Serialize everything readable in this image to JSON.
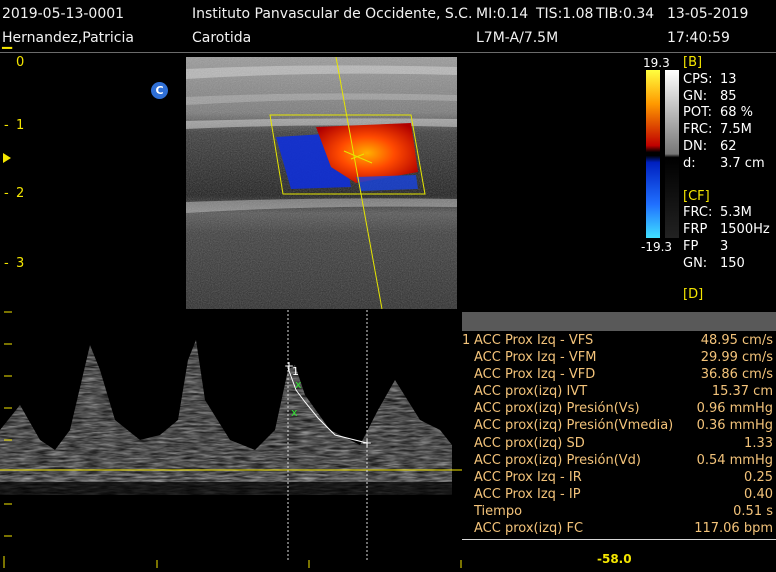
{
  "header": {
    "study_id": "2019-05-13-0001",
    "patient_name": "Hernandez,Patricia",
    "institution": "Instituto Panvascular de Occidente, S.C.",
    "mi": "MI:0.14",
    "tis": "TIS:1.08",
    "tib": "TIB:0.34",
    "date": "13-05-2019",
    "exam": "Carotida",
    "probe": "L7M-A/7.5M",
    "time": "17:40:59"
  },
  "depth_scale": [
    "0",
    "1",
    "2",
    "3"
  ],
  "badge": "C",
  "colorbar": {
    "max": "19.3",
    "min": "-19.3"
  },
  "b_params": {
    "title": "[B]",
    "rows": [
      {
        "k": "CPS:",
        "v": "13"
      },
      {
        "k": "GN:",
        "v": "85"
      },
      {
        "k": "POT:",
        "v": "68 %"
      },
      {
        "k": "FRC:",
        "v": "7.5M"
      },
      {
        "k": "DN:",
        "v": "62"
      },
      {
        "k": "d:",
        "v": "3.7 cm"
      }
    ]
  },
  "cf_params": {
    "title": "[CF]",
    "rows": [
      {
        "k": "FRC:",
        "v": "5.3M"
      },
      {
        "k": "FRP",
        "v": "1500Hz"
      },
      {
        "k": "FP",
        "v": "3"
      },
      {
        "k": "GN:",
        "v": "150"
      }
    ]
  },
  "d_params": {
    "title": "[D]"
  },
  "measurements": {
    "index": "1",
    "rows": [
      {
        "label": "ACC Prox Izq - VFS",
        "value": "48.95 cm/s"
      },
      {
        "label": "ACC Prox Izq - VFM",
        "value": "29.99 cm/s"
      },
      {
        "label": "ACC Prox Izq - VFD",
        "value": "36.86 cm/s"
      },
      {
        "label": "ACC prox(izq) IVT",
        "value": "15.37 cm"
      },
      {
        "label": "ACC prox(izq) Presión(Vs)",
        "value": "0.96 mmHg"
      },
      {
        "label": "ACC prox(izq) Presión(Vmedia)",
        "value": "0.36 mmHg"
      },
      {
        "label": "ACC prox(izq) SD",
        "value": "1.33"
      },
      {
        "label": "ACC prox(izq) Presión(Vd)",
        "value": "0.54 mmHg"
      },
      {
        "label": "ACC Prox Izq - IR",
        "value": "0.25"
      },
      {
        "label": "ACC Prox Izq - IP",
        "value": "0.40"
      },
      {
        "label": "Tiempo",
        "value": "0.51 s"
      },
      {
        "label": "ACC prox(izq) FC",
        "value": "117.06 bpm"
      }
    ]
  },
  "doppler": {
    "cursor_label": "1",
    "scale_value": "-58.0"
  },
  "colors": {
    "accent_yellow": "#f5e600",
    "measurement_text": "#f3c37a"
  }
}
